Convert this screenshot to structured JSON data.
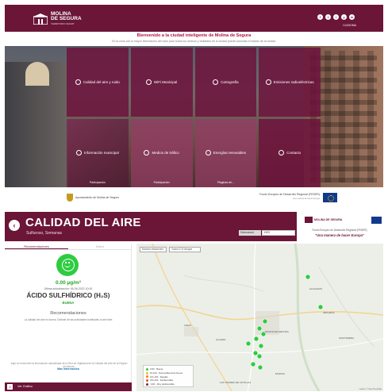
{
  "top": {
    "logo": {
      "line1": "MOLINA",
      "line2": "DE SEGURA",
      "line3": "TERRITORIO SMART"
    },
    "social": [
      "f",
      "t",
      "i",
      "y",
      "in"
    ],
    "lang_label": "CLIDIOMA",
    "welcome_title": "Bienvenido a la ciudad inteligente de Molina de Segura",
    "welcome_text": "En la zona con la mayor información del valor para todos los vecinos y visitantes de la ciudad puede consultar el estado de la ciudad.",
    "tiles": [
      {
        "label": "Calidad del aire y ruido",
        "icon": "cloud-icon"
      },
      {
        "label": "WiFi Municipal",
        "icon": "wifi-icon"
      },
      {
        "label": "Cartografía",
        "icon": "map-pin-icon"
      },
      {
        "label": "Emisiones radioeléctricas",
        "icon": "antenna-icon"
      },
      {
        "label": "Información municipal",
        "icon": "info-icon"
      },
      {
        "label": "Medios de tráfico",
        "icon": "car-icon"
      },
      {
        "label": "Energías renovables",
        "icon": "energy-icon"
      },
      {
        "label": "Contacto",
        "icon": "mail-icon"
      }
    ],
    "tile_subs": [
      "Participación",
      "Participación",
      "Pláginas de..."
    ],
    "footer_left": "Ayuntamiento de Molina de Segura",
    "footer_right": "Fondo Europeo de Desarrollo Regional (FEDER)",
    "footer_right_small": "Una manera de hacer Europa"
  },
  "bottom": {
    "title": "CALIDAD DEL AIRE",
    "subtitle": "Sulfuroso, Semanas",
    "select_label": "Seleccione",
    "select_value": "H2S",
    "brand": {
      "logo": "MOLINA DE SEGURA",
      "feder": "Fondo Europeo de Desarrollo Regional (FEDER)",
      "slogan": "\"Una manera de hacer Europa\""
    },
    "tabs": [
      "Recomendaciones",
      "Índice"
    ],
    "value": "0.00 µg/m³",
    "updated": "Última actualización: 06-06-2022 10:00",
    "pollutant": "ÁCIDO SULFHÍDRICO (H₂S)",
    "quality": "BUENA",
    "rec_heading": "Recomendaciones",
    "rec_text": "La calidad del aire es buena. Disfrute de las actividades habituales al aire libre.",
    "note": "Aquí se encuentra la información actualizada de la Red de Vigilancia de la Calidad del Aire de la Región de Murcia.",
    "more_link": "Más Información",
    "bar_label": "Ver Gráfico",
    "map_controls": [
      "Mostrar estaciones",
      "Todos ICA Vitoque"
    ],
    "legend": [
      {
        "label": "0-50 · Buena",
        "color": "#2ecc40"
      },
      {
        "label": "51-100 · Razonablemente buena",
        "color": "#f1c40f"
      },
      {
        "label": "101-150 · Regular",
        "color": "#e67e22"
      },
      {
        "label": "151-200 · Desfavorable",
        "color": "#e74c3c"
      },
      {
        "label": ">200 · Muy desfavorable",
        "color": "#8e2442"
      }
    ],
    "towns": [
      "ALGUAZAS",
      "ARCHENA",
      "MOLINA DE SEGURA",
      "CIEZA",
      "ALHAMA",
      "LAS TORRES DE COTILLAS",
      "SANTOMERA",
      "MURCIA"
    ],
    "attribution": "Leaflet | © OpenStreetMap"
  },
  "colors": {
    "brand": "#6b1537",
    "good": "#2ecc40"
  }
}
